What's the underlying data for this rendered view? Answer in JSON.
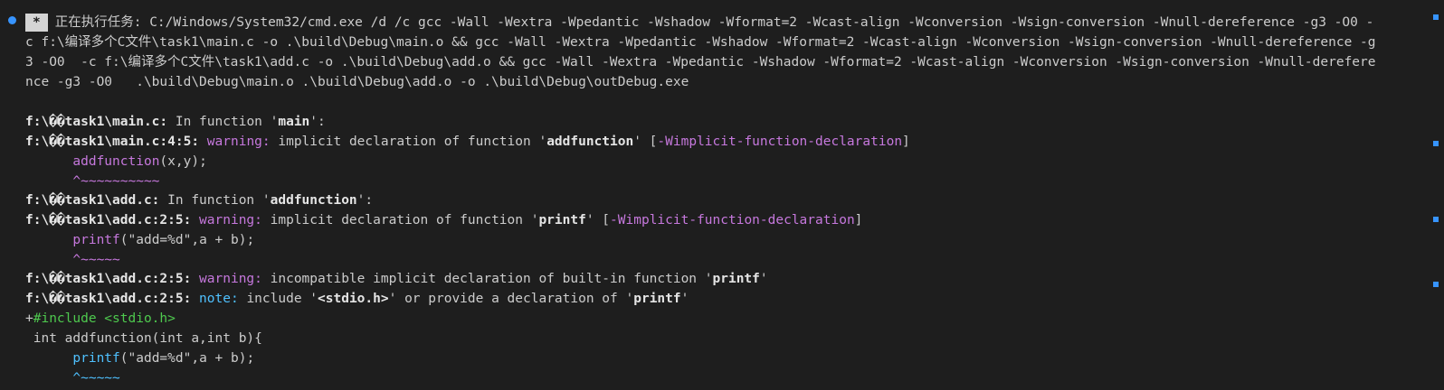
{
  "task": {
    "badge": "*",
    "label": "正在执行任务:",
    "command_1": " C:/Windows/System32/cmd.exe /d /c gcc -Wall -Wextra -Wpedantic -Wshadow -Wformat=2 -Wcast-align -Wconversion -Wsign-conversion -Wnull-dereference -g3 -O0 -",
    "command_2": "c f:\\编译多个C文件\\task1\\main.c -o .\\build\\Debug\\main.o && gcc -Wall -Wextra -Wpedantic -Wshadow -Wformat=2 -Wcast-align -Wconversion -Wsign-conversion -Wnull-dereference -g",
    "command_3": "3 -O0  -c f:\\编译多个C文件\\task1\\add.c -o .\\build\\Debug\\add.o && gcc -Wall -Wextra -Wpedantic -Wshadow -Wformat=2 -Wcast-align -Wconversion -Wsign-conversion -Wnull-derefere",
    "command_4": "nce -g3 -O0   .\\build\\Debug\\main.o .\\build\\Debug\\add.o -o .\\build\\Debug\\outDebug.exe"
  },
  "output": {
    "main_file": "f:\\��task1\\main.c:",
    "main_in_function": " In function '",
    "main_fn_name": "main",
    "main_fn_close": "':",
    "w1_loc": "f:\\��task1\\main.c:4:5:",
    "w1_kind": " warning:",
    "w1_msg_a": " implicit declaration of function '",
    "w1_fn": "addfunction",
    "w1_msg_b": "' [",
    "w1_flag": "-Wimplicit-function-declaration",
    "w1_close": "]",
    "w1_code_indent": "      ",
    "w1_code_hl": "addfunction",
    "w1_code_rest": "(x,y);",
    "w1_caret": "      ^~~~~~~~~~~",
    "add_file": "f:\\��task1\\add.c:",
    "add_in_function": " In function '",
    "add_fn_name": "addfunction",
    "add_fn_close": "':",
    "w2_loc": "f:\\��task1\\add.c:2:5:",
    "w2_kind": " warning:",
    "w2_msg_a": " implicit declaration of function '",
    "w2_fn": "printf",
    "w2_msg_b": "' [",
    "w2_flag": "-Wimplicit-function-declaration",
    "w2_close": "]",
    "w2_code_indent": "      ",
    "w2_code_hl": "printf",
    "w2_code_rest": "(\"add=%d\",a + b);",
    "w2_caret": "      ^~~~~~",
    "w3_loc": "f:\\��task1\\add.c:2:5:",
    "w3_kind": " warning:",
    "w3_msg_a": " incompatible implicit declaration of built-in function '",
    "w3_fn": "printf",
    "w3_msg_b": "'",
    "n1_loc": "f:\\��task1\\add.c:2:5:",
    "n1_kind": " note:",
    "n1_msg_a": " include '",
    "n1_header": "<stdio.h>",
    "n1_msg_b": "' or provide a declaration of '",
    "n1_fn": "printf",
    "n1_msg_c": "'",
    "fix_plus": "+",
    "fix_include": "#include <stdio.h>",
    "src_line": " int addfunction(int a,int b){",
    "n1_code_indent": "      ",
    "n1_code_hl": "printf",
    "n1_code_rest": "(\"add=%d\",a + b);",
    "n1_caret": "      ^~~~~~"
  },
  "colors": {
    "background": "#1e1e1e",
    "text": "#cccccc",
    "warning": "#c678dd",
    "note": "#4fc1ff",
    "fixit": "#4ec94e",
    "marker": "#3794ff"
  }
}
